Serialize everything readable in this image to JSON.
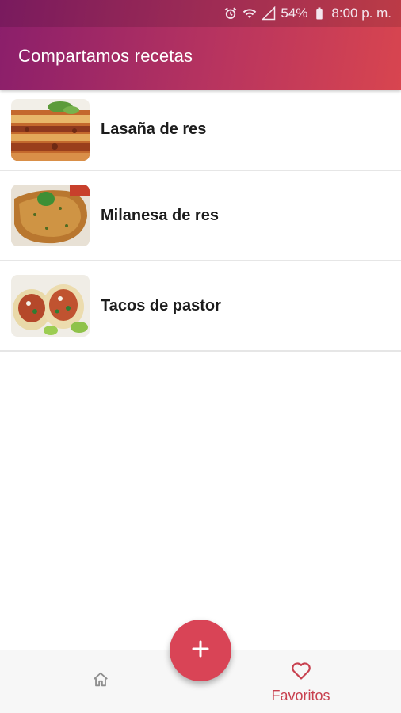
{
  "status_bar": {
    "battery": "54%",
    "time": "8:00 p. m.",
    "icons": [
      "alarm-icon",
      "wifi-icon",
      "signal-icon",
      "battery-icon"
    ]
  },
  "app_bar": {
    "title": "Compartamos recetas"
  },
  "recipes": [
    {
      "name": "Lasaña de res",
      "image": "lasagna-photo"
    },
    {
      "name": "Milanesa de res",
      "image": "milanesa-photo"
    },
    {
      "name": "Tacos de pastor",
      "image": "tacos-photo"
    }
  ],
  "fab": {
    "icon": "plus-icon"
  },
  "bottom_nav": {
    "home": {
      "icon": "home-icon"
    },
    "favorites": {
      "icon": "heart-icon",
      "label": "Favoritos"
    }
  },
  "colors": {
    "header_gradient_start": "#8a1e6b",
    "header_gradient_end": "#d8454f",
    "accent": "#d94456"
  }
}
